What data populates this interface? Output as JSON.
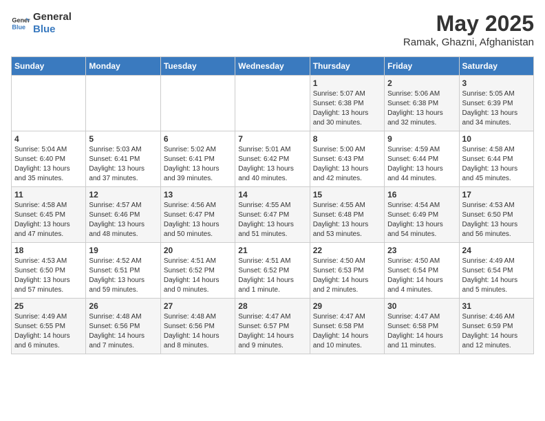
{
  "logo": {
    "line1": "General",
    "line2": "Blue"
  },
  "title": "May 2025",
  "subtitle": "Ramak, Ghazni, Afghanistan",
  "days_of_week": [
    "Sunday",
    "Monday",
    "Tuesday",
    "Wednesday",
    "Thursday",
    "Friday",
    "Saturday"
  ],
  "weeks": [
    [
      {
        "day": "",
        "info": ""
      },
      {
        "day": "",
        "info": ""
      },
      {
        "day": "",
        "info": ""
      },
      {
        "day": "",
        "info": ""
      },
      {
        "day": "1",
        "info": "Sunrise: 5:07 AM\nSunset: 6:38 PM\nDaylight: 13 hours\nand 30 minutes."
      },
      {
        "day": "2",
        "info": "Sunrise: 5:06 AM\nSunset: 6:38 PM\nDaylight: 13 hours\nand 32 minutes."
      },
      {
        "day": "3",
        "info": "Sunrise: 5:05 AM\nSunset: 6:39 PM\nDaylight: 13 hours\nand 34 minutes."
      }
    ],
    [
      {
        "day": "4",
        "info": "Sunrise: 5:04 AM\nSunset: 6:40 PM\nDaylight: 13 hours\nand 35 minutes."
      },
      {
        "day": "5",
        "info": "Sunrise: 5:03 AM\nSunset: 6:41 PM\nDaylight: 13 hours\nand 37 minutes."
      },
      {
        "day": "6",
        "info": "Sunrise: 5:02 AM\nSunset: 6:41 PM\nDaylight: 13 hours\nand 39 minutes."
      },
      {
        "day": "7",
        "info": "Sunrise: 5:01 AM\nSunset: 6:42 PM\nDaylight: 13 hours\nand 40 minutes."
      },
      {
        "day": "8",
        "info": "Sunrise: 5:00 AM\nSunset: 6:43 PM\nDaylight: 13 hours\nand 42 minutes."
      },
      {
        "day": "9",
        "info": "Sunrise: 4:59 AM\nSunset: 6:44 PM\nDaylight: 13 hours\nand 44 minutes."
      },
      {
        "day": "10",
        "info": "Sunrise: 4:58 AM\nSunset: 6:44 PM\nDaylight: 13 hours\nand 45 minutes."
      }
    ],
    [
      {
        "day": "11",
        "info": "Sunrise: 4:58 AM\nSunset: 6:45 PM\nDaylight: 13 hours\nand 47 minutes."
      },
      {
        "day": "12",
        "info": "Sunrise: 4:57 AM\nSunset: 6:46 PM\nDaylight: 13 hours\nand 48 minutes."
      },
      {
        "day": "13",
        "info": "Sunrise: 4:56 AM\nSunset: 6:47 PM\nDaylight: 13 hours\nand 50 minutes."
      },
      {
        "day": "14",
        "info": "Sunrise: 4:55 AM\nSunset: 6:47 PM\nDaylight: 13 hours\nand 51 minutes."
      },
      {
        "day": "15",
        "info": "Sunrise: 4:55 AM\nSunset: 6:48 PM\nDaylight: 13 hours\nand 53 minutes."
      },
      {
        "day": "16",
        "info": "Sunrise: 4:54 AM\nSunset: 6:49 PM\nDaylight: 13 hours\nand 54 minutes."
      },
      {
        "day": "17",
        "info": "Sunrise: 4:53 AM\nSunset: 6:50 PM\nDaylight: 13 hours\nand 56 minutes."
      }
    ],
    [
      {
        "day": "18",
        "info": "Sunrise: 4:53 AM\nSunset: 6:50 PM\nDaylight: 13 hours\nand 57 minutes."
      },
      {
        "day": "19",
        "info": "Sunrise: 4:52 AM\nSunset: 6:51 PM\nDaylight: 13 hours\nand 59 minutes."
      },
      {
        "day": "20",
        "info": "Sunrise: 4:51 AM\nSunset: 6:52 PM\nDaylight: 14 hours\nand 0 minutes."
      },
      {
        "day": "21",
        "info": "Sunrise: 4:51 AM\nSunset: 6:52 PM\nDaylight: 14 hours\nand 1 minute."
      },
      {
        "day": "22",
        "info": "Sunrise: 4:50 AM\nSunset: 6:53 PM\nDaylight: 14 hours\nand 2 minutes."
      },
      {
        "day": "23",
        "info": "Sunrise: 4:50 AM\nSunset: 6:54 PM\nDaylight: 14 hours\nand 4 minutes."
      },
      {
        "day": "24",
        "info": "Sunrise: 4:49 AM\nSunset: 6:54 PM\nDaylight: 14 hours\nand 5 minutes."
      }
    ],
    [
      {
        "day": "25",
        "info": "Sunrise: 4:49 AM\nSunset: 6:55 PM\nDaylight: 14 hours\nand 6 minutes."
      },
      {
        "day": "26",
        "info": "Sunrise: 4:48 AM\nSunset: 6:56 PM\nDaylight: 14 hours\nand 7 minutes."
      },
      {
        "day": "27",
        "info": "Sunrise: 4:48 AM\nSunset: 6:56 PM\nDaylight: 14 hours\nand 8 minutes."
      },
      {
        "day": "28",
        "info": "Sunrise: 4:47 AM\nSunset: 6:57 PM\nDaylight: 14 hours\nand 9 minutes."
      },
      {
        "day": "29",
        "info": "Sunrise: 4:47 AM\nSunset: 6:58 PM\nDaylight: 14 hours\nand 10 minutes."
      },
      {
        "day": "30",
        "info": "Sunrise: 4:47 AM\nSunset: 6:58 PM\nDaylight: 14 hours\nand 11 minutes."
      },
      {
        "day": "31",
        "info": "Sunrise: 4:46 AM\nSunset: 6:59 PM\nDaylight: 14 hours\nand 12 minutes."
      }
    ]
  ]
}
